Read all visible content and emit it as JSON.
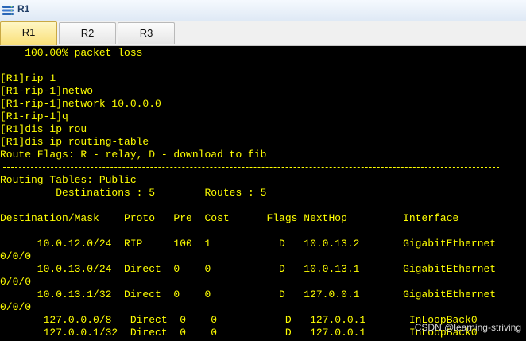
{
  "window": {
    "title": "R1",
    "app_icon": "huawei-ensp-device-icon"
  },
  "tabs": [
    {
      "label": "R1",
      "active": true
    },
    {
      "label": "R2",
      "active": false
    },
    {
      "label": "R3",
      "active": false
    }
  ],
  "terminal": {
    "lines": [
      "    100.00% packet loss",
      "",
      "[R1]rip 1",
      "[R1-rip-1]netwo",
      "[R1-rip-1]network 10.0.0.0",
      "[R1-rip-1]q",
      "[R1]dis ip rou",
      "[R1]dis ip routing-table",
      "Route Flags: R - relay, D - download to fib",
      "",
      "Routing Tables: Public",
      "         Destinations : 5        Routes : 5",
      "",
      "Destination/Mask    Proto   Pre  Cost      Flags NextHop         Interface",
      "",
      "      10.0.12.0/24  RIP     100  1           D   10.0.13.2       GigabitEthernet",
      "0/0/0",
      "      10.0.13.0/24  Direct  0    0           D   10.0.13.1       GigabitEthernet",
      "0/0/0",
      "      10.0.13.1/32  Direct  0    0           D   127.0.0.1       GigabitEthernet",
      "0/0/0",
      "       127.0.0.0/8   Direct  0    0           D   127.0.0.1       InLoopBack0",
      "       127.0.0.1/32  Direct  0    0           D   127.0.0.1       InLoopBack0"
    ]
  },
  "watermark": "CSDN @learning-striving",
  "colors": {
    "terminal_bg": "#000000",
    "terminal_text": "#ffff00",
    "active_tab": "#f9e07a"
  }
}
